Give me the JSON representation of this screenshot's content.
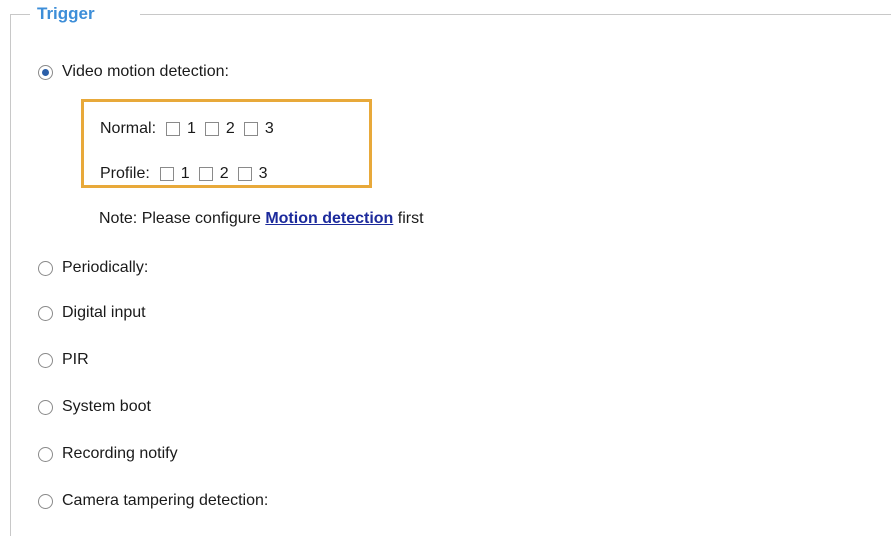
{
  "legend": "Trigger",
  "video_motion": {
    "label": "Video motion detection:",
    "selected": true,
    "normal": {
      "label": "Normal:",
      "options": [
        "1",
        "2",
        "3"
      ]
    },
    "profile": {
      "label": "Profile:",
      "options": [
        "1",
        "2",
        "3"
      ]
    },
    "note_prefix": "Note: Please configure ",
    "note_link": "Motion detection",
    "note_suffix": " first"
  },
  "options": [
    {
      "label": "Periodically:",
      "selected": false
    },
    {
      "label": "Digital input",
      "selected": false
    },
    {
      "label": "PIR",
      "selected": false
    },
    {
      "label": "System boot",
      "selected": false
    },
    {
      "label": "Recording notify",
      "selected": false
    },
    {
      "label": "Camera tampering detection:",
      "selected": false
    }
  ],
  "colors": {
    "legend": "#3d8ed8",
    "highlight_border": "#e8a93a",
    "link": "#1c2a9c"
  }
}
